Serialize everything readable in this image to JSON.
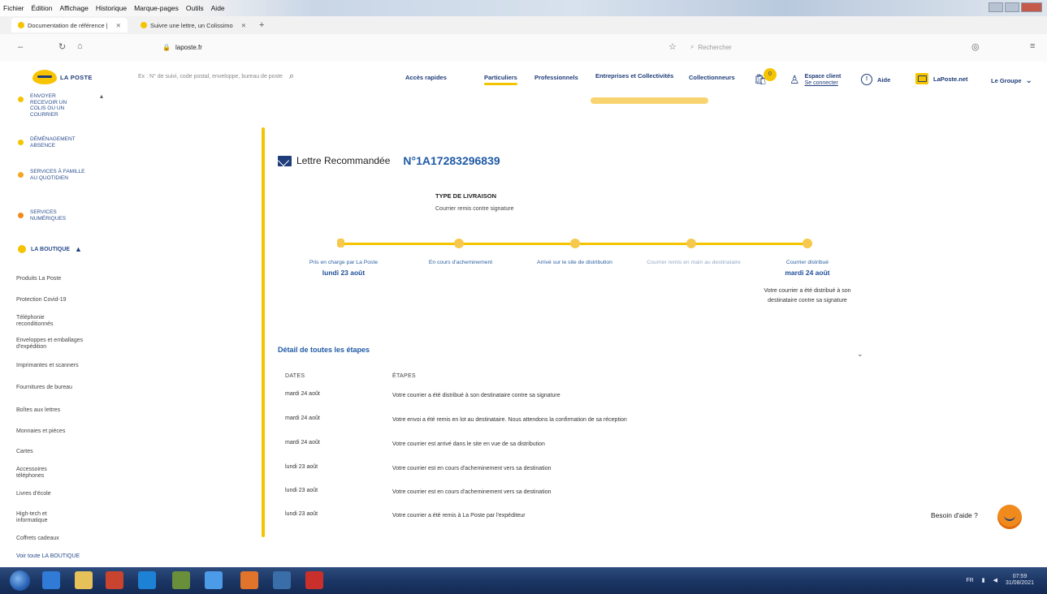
{
  "browser": {
    "menu": [
      "Fichier",
      "Édition",
      "Affichage",
      "Historique",
      "Marque-pages",
      "Outils",
      "Aide"
    ],
    "tabs": [
      {
        "label": "Documentation de référence |",
        "active": true
      },
      {
        "label": "Suivre une lettre, un Colissimo",
        "active": false
      }
    ],
    "url_host": "laposte.fr",
    "search_placeholder": "Rechercher"
  },
  "sidebar": {
    "logo": "LA POSTE",
    "categories": [
      {
        "label": "ENVOYER RECEVOIR UN COLIS OU UN COURRIER",
        "color": "#f5c400"
      },
      {
        "label": "DÉMÉNAGEMENT ABSENCE",
        "color": "#f5c400"
      },
      {
        "label": "SERVICES À FAMILLE AU QUOTIDIEN",
        "color": "#f5a623"
      },
      {
        "label": "SERVICES NUMÉRIQUES",
        "color": "#f08a1c"
      }
    ],
    "boutique_label": "LA BOUTIQUE",
    "boutique_items": [
      "Produits La Poste",
      "Protection Covid-19",
      "Téléphonie reconditionnés",
      "Enveloppes et emballages d'expédition",
      "Imprimantes et scanners",
      "Fournitures de bureau",
      "Boîtes aux lettres",
      "Monnaies et pièces",
      "Cartes",
      "Accessoires téléphones",
      "Livres d'école",
      "High-tech et informatique",
      "Coffrets cadeaux"
    ],
    "voir_boutique": "Voir toute LA BOUTIQUE"
  },
  "header": {
    "search_placeholder": "Ex : N° de suivi, code postal, enveloppe, bureau de poste",
    "nav": [
      "Accès rapides",
      "Particuliers",
      "Professionnels",
      "Entreprises et Collectivités",
      "Collectionneurs"
    ],
    "active_nav": "Particuliers",
    "cart_count": "0",
    "espace_client": "Espace client",
    "espace_client_sub": "Se connecter",
    "aide": "Aide",
    "laposte_net": "LaPoste.net",
    "groupe": "Le Groupe"
  },
  "tracking": {
    "title": "Lettre Recommandée",
    "number": "N°1A17283296839",
    "type_label": "TYPE DE LIVRAISON",
    "type_value": "Courrier remis contre signature",
    "steps": [
      {
        "label": "Pris en charge par La Poste",
        "date": "lundi 23 août"
      },
      {
        "label": "En cours d'acheminement",
        "date": ""
      },
      {
        "label": "Arrivé sur le site de distribution",
        "date": ""
      },
      {
        "label": "Courrier remis en main au destinataire",
        "date": ""
      },
      {
        "label": "Courrier distribué",
        "date": "mardi 24 août"
      }
    ],
    "final_desc": "Votre courrier a été distribué à son destinataire contre sa signature",
    "detail_title": "Détail de toutes les étapes",
    "col_dates": "DATES",
    "col_etapes": "ÉTAPES",
    "rows": [
      {
        "date": "mardi 24 août",
        "text": "Votre courrier a été distribué à son destinataire contre sa signature"
      },
      {
        "date": "mardi 24 août",
        "text": "Votre envoi a été remis en lot au destinataire. Nous attendons la confirmation de sa réception"
      },
      {
        "date": "mardi 24 août",
        "text": "Votre courrier est arrivé dans le site en vue de sa distribution"
      },
      {
        "date": "lundi 23 août",
        "text": "Votre courrier est en cours d'acheminement vers sa destination"
      },
      {
        "date": "lundi 23 août",
        "text": "Votre courrier est en cours d'acheminement vers sa destination"
      },
      {
        "date": "lundi 23 août",
        "text": "Votre courrier a été remis à La Poste par l'expéditeur"
      }
    ],
    "besoin_aide": "Besoin d'aide ?"
  },
  "taskbar": {
    "lang": "FR",
    "time": "07:59",
    "date": "31/08/2021"
  },
  "colors": {
    "brand_yellow": "#f5c400",
    "brand_blue": "#1f3d7a",
    "link_blue": "#1f5aa6"
  }
}
